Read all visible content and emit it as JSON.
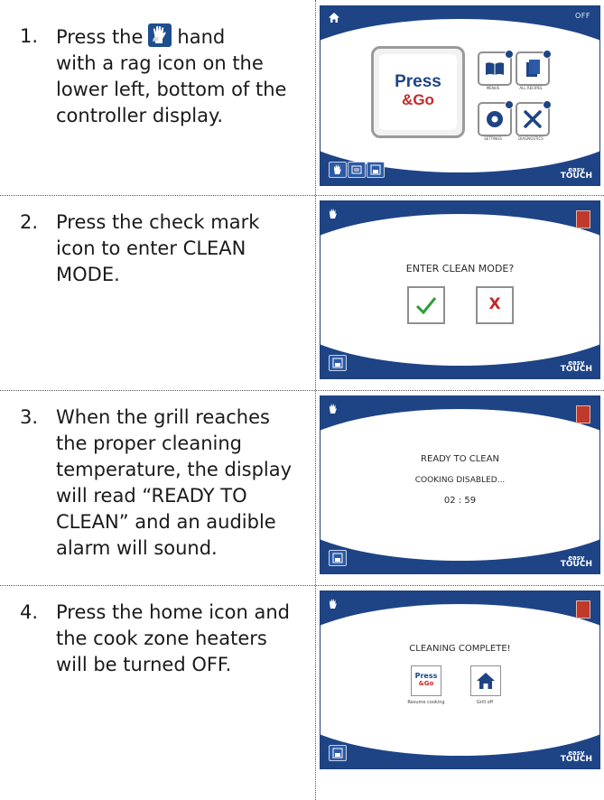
{
  "steps": [
    {
      "number": "1.",
      "lines": [
        "Press the",
        "hand",
        "with a rag icon on the",
        "lower left, bottom of the",
        "controller display."
      ]
    },
    {
      "number": "2.",
      "lines": [
        "Press the check mark",
        "icon to enter CLEAN",
        "MODE."
      ]
    },
    {
      "number": "3.",
      "lines": [
        "When the grill reaches",
        "the proper cleaning",
        "temperature, the display",
        "will read “READY TO",
        "CLEAN” and an audible",
        "alarm will sound."
      ]
    },
    {
      "number": "4.",
      "lines": [
        "Press the home icon and",
        "the cook zone heaters",
        "will be turned OFF."
      ]
    }
  ],
  "screens": {
    "home": {
      "status": "OFF",
      "press_word": "Press",
      "go_word": "&Go",
      "tiles": [
        {
          "label": "MENUS",
          "icon": "book-icon"
        },
        {
          "label": "ALL RECIPES",
          "icon": "recipes-icon"
        },
        {
          "label": "SETTINGS",
          "icon": "gear-icon"
        },
        {
          "label": "DIAGNOSTICS",
          "icon": "tools-icon"
        }
      ],
      "brand_small": "easy",
      "brand_big": "TOUCH"
    },
    "clean_prompt": {
      "message": "ENTER CLEAN MODE?",
      "confirm_icon": "check-icon",
      "cancel_symbol": "X",
      "brand_small": "easy",
      "brand_big": "TOUCH"
    },
    "ready": {
      "line1": "READY TO CLEAN",
      "line2": "COOKING DISABLED...",
      "timer": "02 : 59",
      "brand_small": "easy",
      "brand_big": "TOUCH"
    },
    "complete": {
      "message": "CLEANING COMPLETE!",
      "resume_label": "Resume cooking",
      "grill_off_label": "Grill off",
      "press_word": "Press",
      "go_word": "&Go",
      "brand_small": "easy",
      "brand_big": "TOUCH"
    }
  },
  "colors": {
    "panel_blue": "#1e4486",
    "check_green": "#2e9e3a",
    "cancel_red": "#c62828"
  }
}
